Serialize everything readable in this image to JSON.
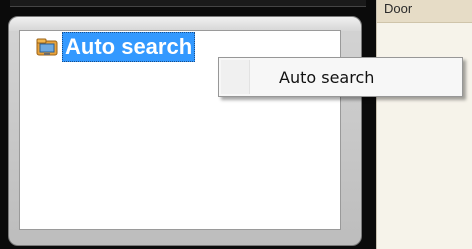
{
  "side_panel": {
    "header_label": "Door"
  },
  "tree": {
    "item": {
      "label": "Auto search",
      "icon": "folder-computer-icon"
    }
  },
  "context_menu": {
    "items": [
      {
        "label": "Auto search"
      }
    ]
  },
  "colors": {
    "selection": "#3399ff",
    "panel_bg": "#f6f3ea",
    "panel_header": "#e6dcc6"
  }
}
